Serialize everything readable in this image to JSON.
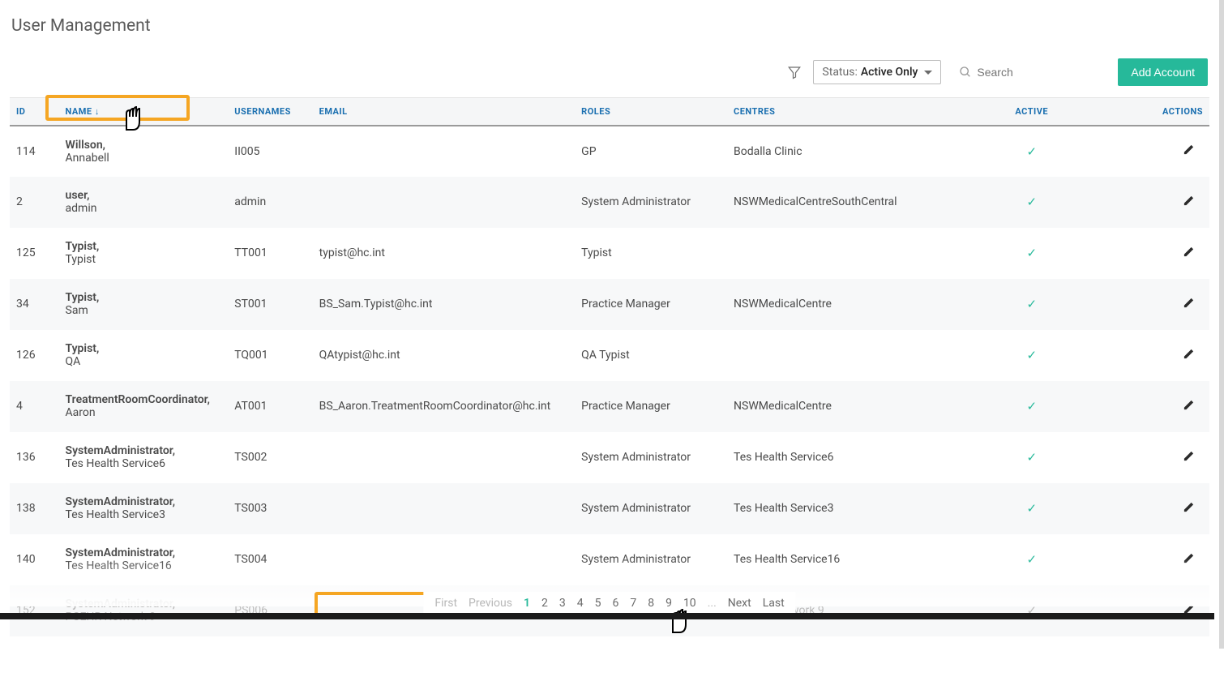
{
  "title": "User Management",
  "toolbar": {
    "status_label": "Status:",
    "status_value": "Active Only",
    "search_placeholder": "Search",
    "add_label": "Add Account"
  },
  "columns": {
    "id": "ID",
    "name": "NAME",
    "usernames": "USERNAMES",
    "email": "EMAIL",
    "roles": "ROLES",
    "centres": "CENTRES",
    "active": "ACTIVE",
    "actions": "ACTIONS"
  },
  "sort": {
    "column": "name",
    "direction": "desc",
    "arrow": "↓"
  },
  "rows": [
    {
      "id": "114",
      "surname": "Willson,",
      "given": "Annabell",
      "username": "II005",
      "email": "",
      "roles": "GP",
      "centres": "Bodalla Clinic",
      "active": true
    },
    {
      "id": "2",
      "surname": "user,",
      "given": "admin",
      "username": "admin",
      "email": "",
      "roles": "System Administrator",
      "centres": "NSWMedicalCentreSouthCentral",
      "active": true
    },
    {
      "id": "125",
      "surname": "Typist,",
      "given": "Typist",
      "username": "TT001",
      "email": "typist@hc.int",
      "roles": "Typist",
      "centres": "",
      "active": true
    },
    {
      "id": "34",
      "surname": "Typist,",
      "given": "Sam",
      "username": "ST001",
      "email": "BS_Sam.Typist@hc.int",
      "roles": "Practice Manager",
      "centres": "NSWMedicalCentre",
      "active": true
    },
    {
      "id": "126",
      "surname": "Typist,",
      "given": "QA",
      "username": "TQ001",
      "email": "QAtypist@hc.int",
      "roles": "QA Typist",
      "centres": "",
      "active": true
    },
    {
      "id": "4",
      "surname": "TreatmentRoomCoordinator,",
      "given": "Aaron",
      "username": "AT001",
      "email": "BS_Aaron.TreatmentRoomCoordinator@hc.int",
      "roles": "Practice Manager",
      "centres": "NSWMedicalCentre",
      "active": true
    },
    {
      "id": "136",
      "surname": "SystemAdministrator,",
      "given": "Tes Health Service6",
      "username": "TS002",
      "email": "",
      "roles": "System Administrator",
      "centres": "Tes Health Service6",
      "active": true
    },
    {
      "id": "138",
      "surname": "SystemAdministrator,",
      "given": "Tes Health Service3",
      "username": "TS003",
      "email": "",
      "roles": "System Administrator",
      "centres": "Tes Health Service3",
      "active": true
    },
    {
      "id": "140",
      "surname": "SystemAdministrator,",
      "given": "Tes Health Service16",
      "username": "TS004",
      "email": "",
      "roles": "System Administrator",
      "centres": "Tes Health Service16",
      "active": true
    },
    {
      "id": "152",
      "surname": "SystemAdministrator,",
      "given": "PCEHR Network 9",
      "username": "PS006",
      "email": "",
      "roles": "System Administrator",
      "centres": "PCEHR Network 9",
      "active": true,
      "faded": true
    }
  ],
  "pagination": {
    "first": "First",
    "previous": "Previous",
    "pages": [
      "1",
      "2",
      "3",
      "4",
      "5",
      "6",
      "7",
      "8",
      "9",
      "10",
      "..."
    ],
    "next": "Next",
    "last": "Last",
    "current": "1"
  }
}
